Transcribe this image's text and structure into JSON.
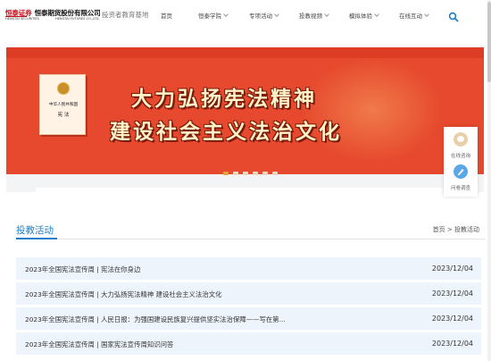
{
  "header": {
    "logo": {
      "brand_cn": "恒泰证券",
      "company_cn": "恒泰期货股份有限公司",
      "brand_en": "HENGTAI SECURITIES",
      "company_en": "HENGTAI FUTURES CO.,LTD."
    },
    "subtitle": "投资者教育基地",
    "nav": [
      "首页",
      "恒泰学院",
      "专项活动",
      "投教视频",
      "模拟体验",
      "在线互动"
    ],
    "search_icon": "search-icon"
  },
  "banner": {
    "line1": "大力弘扬宪法精神",
    "line2": "建设社会主义法治文化",
    "book_title": "中华人民共和国",
    "book_subtitle": "宪 法",
    "colors": {
      "background": "#e6492d",
      "text": "#fff3c8"
    },
    "slide_count": 6,
    "active_slide": 0
  },
  "float_panel": {
    "items": [
      {
        "label": "在线咨询",
        "icon": "chat-icon"
      },
      {
        "label": "问卷调查",
        "icon": "survey-icon"
      }
    ]
  },
  "section": {
    "title": "投教活动",
    "breadcrumb": {
      "home": "首页",
      "sep": ">",
      "current": "投教活动"
    }
  },
  "articles": [
    {
      "title": "2023年全国宪法宣传周 | 宪法在你身边",
      "date": "2023/12/04"
    },
    {
      "title": "2023年全国宪法宣传周 | 大力弘扬宪法精神 建设社会主义法治文化",
      "date": "2023/12/04"
    },
    {
      "title": "2023年全国宪法宣传周 | 人民日报：为强国建设民族复兴提供坚实法治保障——写在第...",
      "date": "2023/12/04"
    },
    {
      "title": "2023年全国宪法宣传周 | 国家宪法宣传周知识问答",
      "date": "2023/12/04"
    }
  ],
  "accent_color": "#1c7ec8"
}
